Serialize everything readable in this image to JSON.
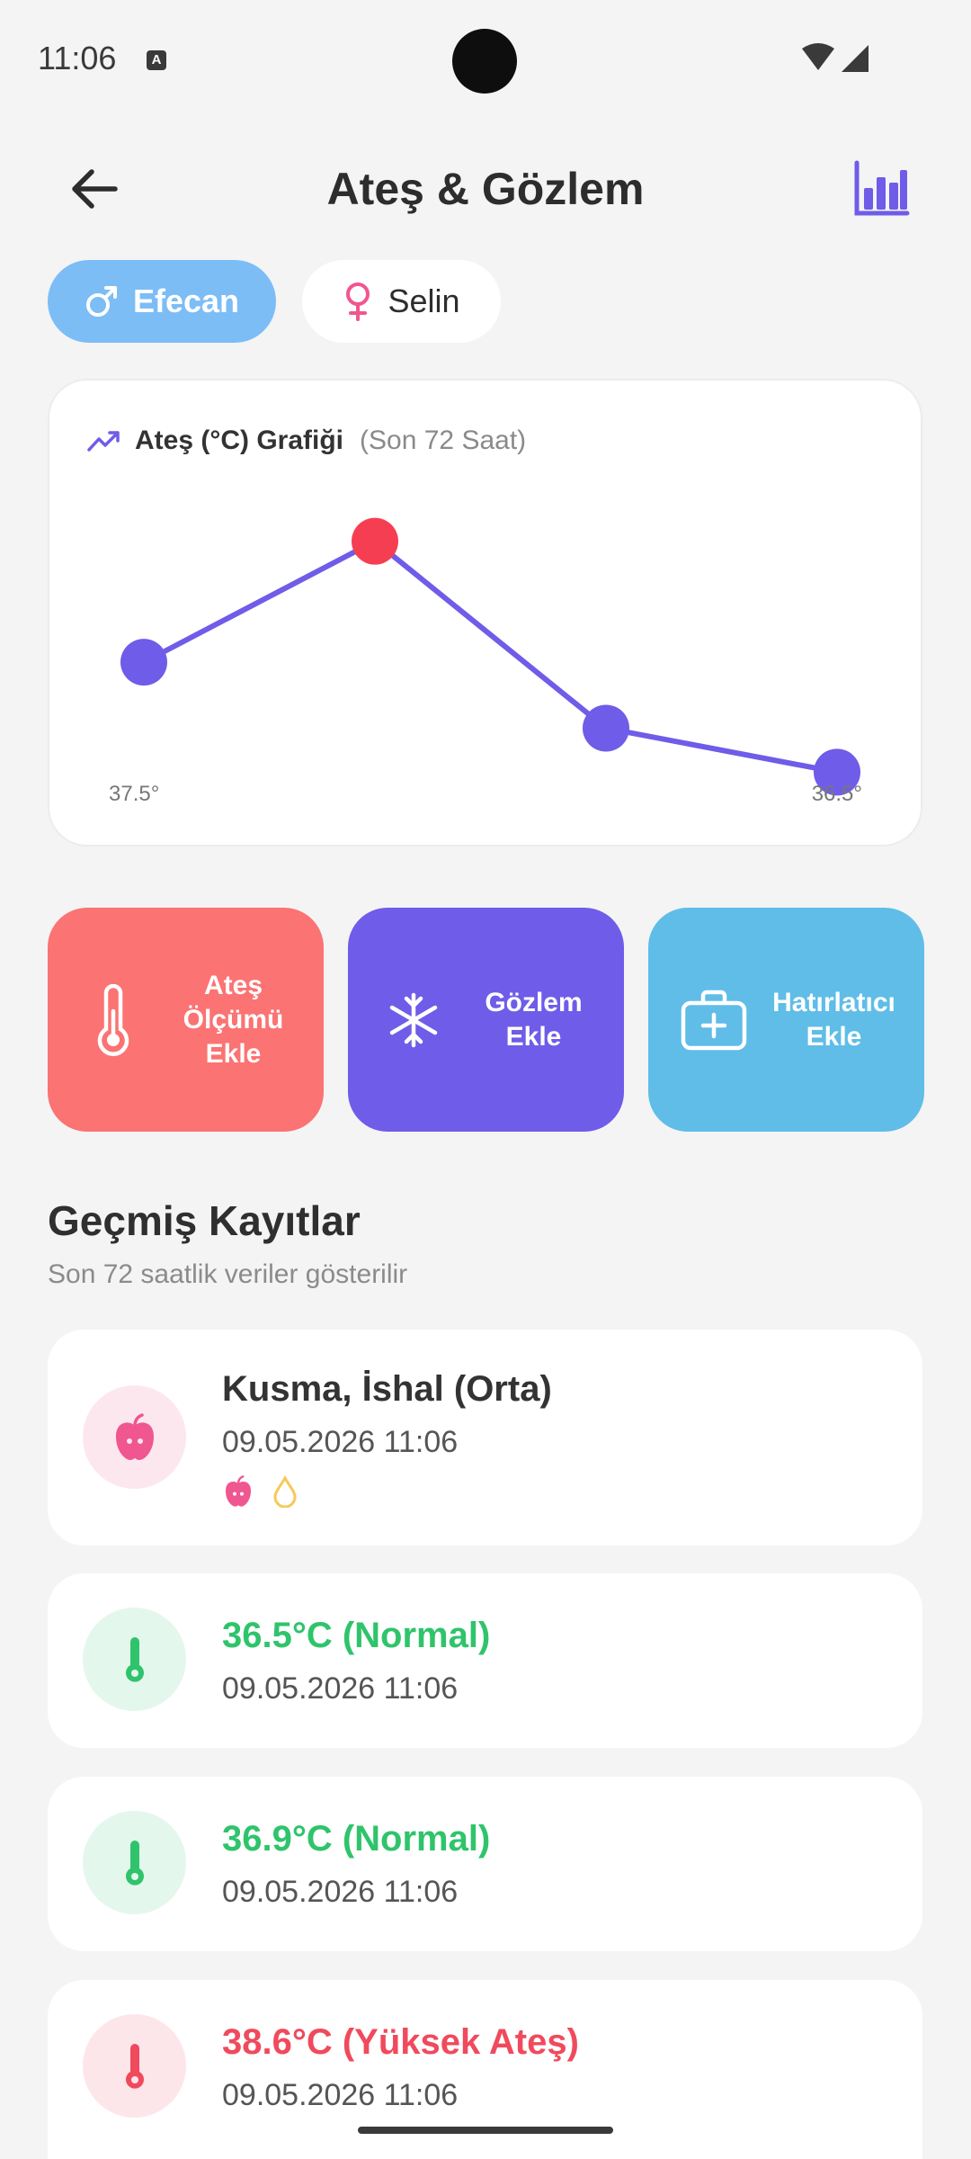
{
  "status_bar": {
    "time": "11:06",
    "notification_badge": "A"
  },
  "header": {
    "title": "Ateş & Gözlem"
  },
  "profiles": [
    {
      "name": "Efecan",
      "gender_icon": "male-icon",
      "selected": true
    },
    {
      "name": "Selin",
      "gender_icon": "female-icon",
      "selected": false
    }
  ],
  "chart_card": {
    "title": "Ateş (°C) Grafiği",
    "subtitle": "(Son 72 Saat)"
  },
  "chart_data": {
    "type": "line",
    "title": "Ateş (°C) Grafiği",
    "subtitle": "(Son 72 Saat)",
    "values": [
      37.5,
      38.6,
      36.9,
      36.5
    ],
    "highlight_index": 1,
    "first_label": "37.5°",
    "last_label": "36.5°",
    "ylim": [
      36.2,
      38.9
    ],
    "line_color": "#6f5ce8",
    "point_color": "#6f5ce8",
    "highlight_color": "#f63e52"
  },
  "actions": [
    {
      "label": "Ateş Ölçümü Ekle",
      "icon": "thermometer-icon",
      "color": "#fb7373"
    },
    {
      "label": "Gözlem Ekle",
      "icon": "asterisk-icon",
      "color": "#6f5ce8"
    },
    {
      "label": "Hatırlatıcı Ekle",
      "icon": "medical-kit-icon",
      "color": "#5fbde8"
    }
  ],
  "history": {
    "title": "Geçmiş Kayıtlar",
    "subtitle": "Son 72 saatlik veriler gösterilir",
    "records": [
      {
        "title": "Kusma, İshal (Orta)",
        "date": "09.05.2026 11:06",
        "icon": "apple-icon",
        "tags": [
          "apple-icon",
          "drop-icon"
        ],
        "color": "#333333"
      },
      {
        "title": "36.5°C (Normal)",
        "date": "09.05.2026 11:06",
        "icon": "thermometer-icon",
        "color": "#2fc46b"
      },
      {
        "title": "36.9°C (Normal)",
        "date": "09.05.2026 11:06",
        "icon": "thermometer-icon",
        "color": "#2fc46b"
      },
      {
        "title": "38.6°C (Yüksek Ateş)",
        "date": "09.05.2026 11:06",
        "icon": "thermometer-icon",
        "color": "#f04a5c"
      }
    ]
  }
}
